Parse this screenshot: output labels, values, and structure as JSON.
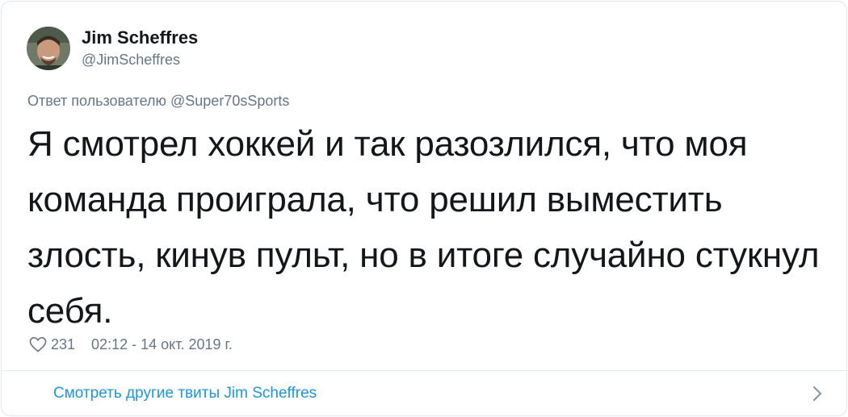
{
  "author": {
    "display_name": "Jim Scheffres",
    "handle": "@JimScheffres"
  },
  "reply_to": "Ответ пользователю @Super70sSports",
  "tweet": {
    "text": "Я смотрел хоккей и так разозлился, что моя команда проиграла, что решил выместить злость, кинув пульт, но в итоге случайно стукнул себя.",
    "likes": "231",
    "timestamp": "02:12 - 14 окт. 2019 г."
  },
  "footer": {
    "more_tweets_label": "Смотреть другие твиты Jim Scheffres"
  },
  "icons": {
    "like": "heart-icon",
    "navigate": "chevron-right-icon"
  },
  "colors": {
    "text_primary": "#14171a",
    "text_secondary": "#657786",
    "link": "#1b95e0",
    "border": "#e1e8ed"
  }
}
